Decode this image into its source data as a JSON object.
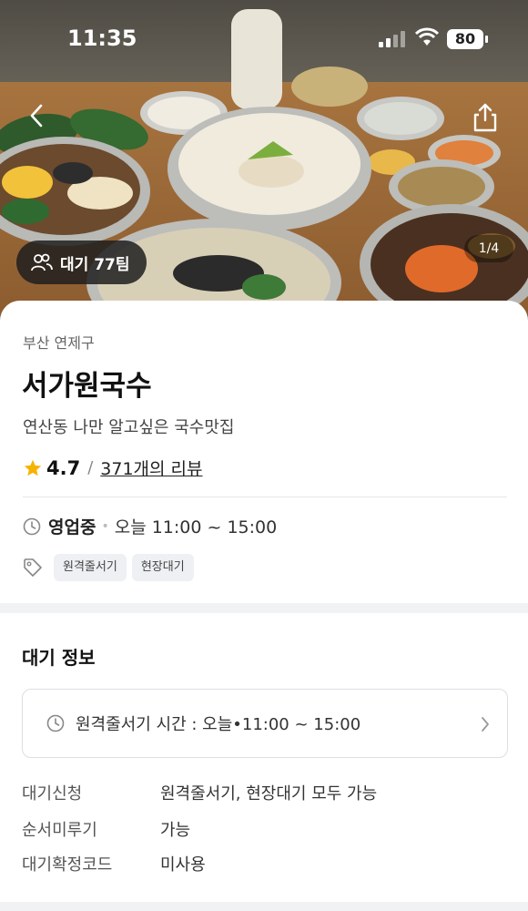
{
  "status_bar": {
    "time": "11:35",
    "battery": "80"
  },
  "hero": {
    "wait_badge": "대기 77팀",
    "image_counter": "1/4"
  },
  "store": {
    "region": "부산 연제구",
    "name": "서가원국수",
    "description": "연산동 나만 알고싶은 국수맛집",
    "rating": "4.7",
    "rating_separator": "/",
    "reviews": "371개의 리뷰",
    "status": "영업중",
    "hours": "오늘 11:00 ~ 15:00",
    "tags": [
      "원격줄서기",
      "현장대기"
    ]
  },
  "wait_info": {
    "title": "대기 정보",
    "remote_queue_time": "원격줄서기 시간 : 오늘•11:00 ~ 15:00",
    "rows": [
      {
        "key": "대기신청",
        "value": "원격줄서기, 현장대기 모두 가능"
      },
      {
        "key": "순서미루기",
        "value": "가능"
      },
      {
        "key": "대기확정코드",
        "value": "미사용"
      }
    ]
  },
  "colors": {
    "star": "#f5b301",
    "badge_bg": "#1e1e1e",
    "tag_bg": "#eef0f3"
  }
}
